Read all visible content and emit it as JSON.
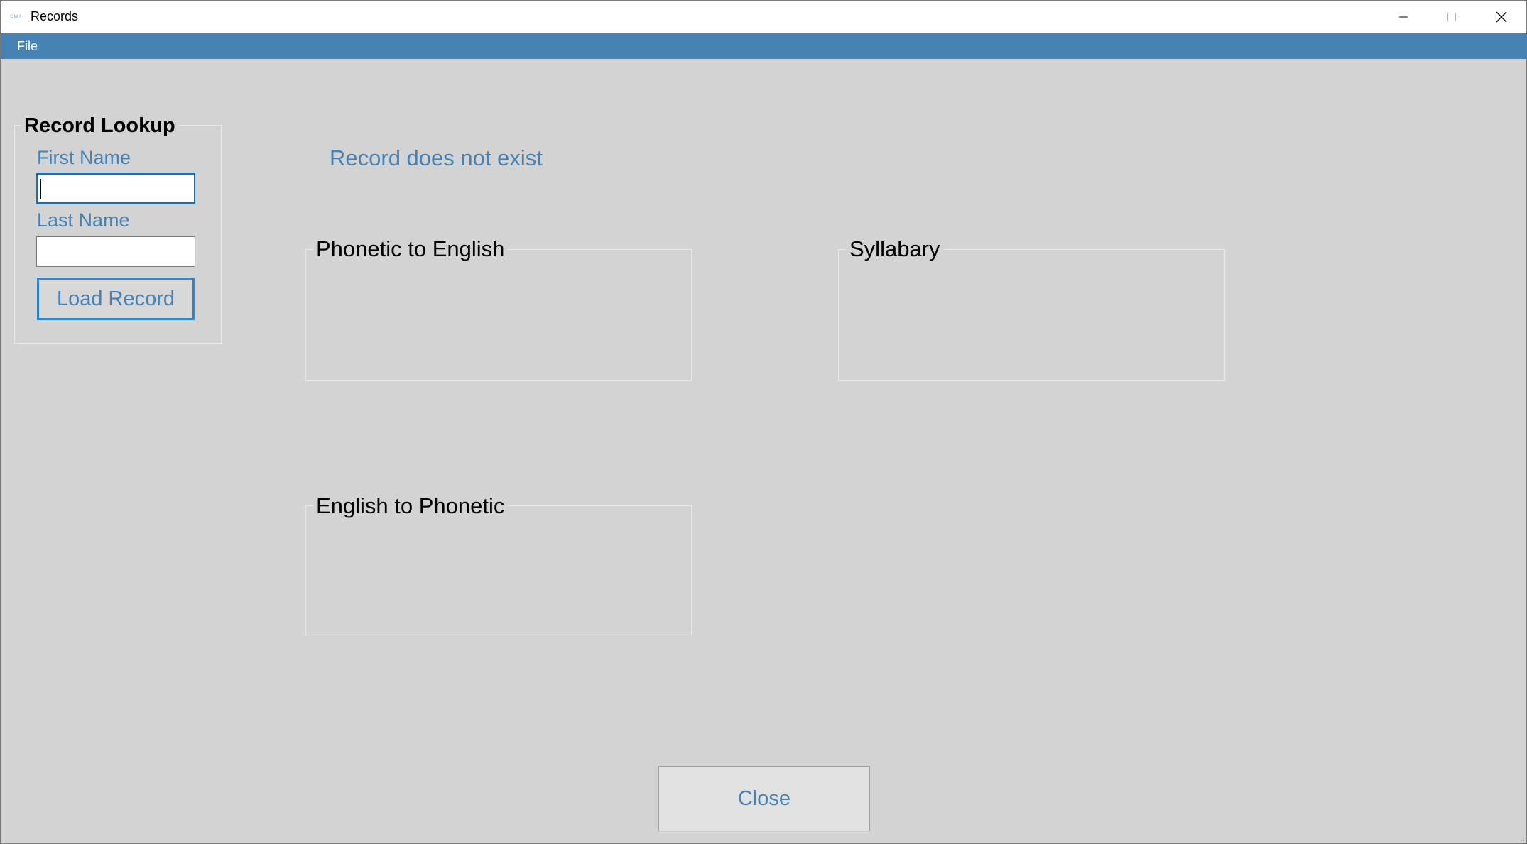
{
  "window": {
    "title": "Records",
    "icon": "app-icon",
    "icon_text": "cwr"
  },
  "menu": {
    "items": [
      {
        "label": "File"
      }
    ]
  },
  "lookup": {
    "title": "Record Lookup",
    "first_name_label": "First Name",
    "first_name_value": "",
    "last_name_label": "Last Name",
    "last_name_value": "",
    "load_button": "Load Record"
  },
  "status": {
    "message": "Record does not exist"
  },
  "panels": {
    "phonetic_to_english": {
      "title": "Phonetic to English"
    },
    "syllabary": {
      "title": "Syllabary"
    },
    "english_to_phonetic": {
      "title": "English to Phonetic"
    }
  },
  "footer": {
    "close_button": "Close"
  },
  "colors": {
    "accent": "#4682b4",
    "background": "#d3d3d3",
    "focus": "#0078d7"
  }
}
